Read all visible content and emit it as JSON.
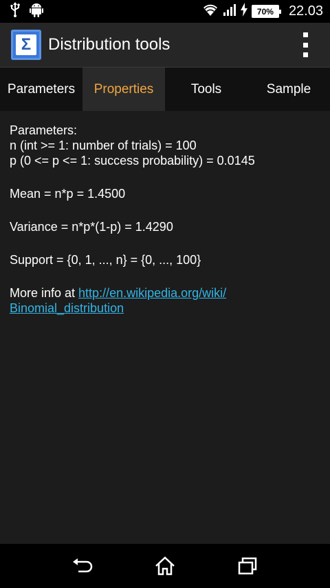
{
  "status_bar": {
    "time": "22.03",
    "battery": "70%",
    "icons": [
      "usb-icon",
      "android-icon",
      "wifi-icon",
      "signal-icon",
      "charging-icon",
      "battery-icon"
    ]
  },
  "action_bar": {
    "app_icon_glyph": "Σ",
    "title": "Distribution tools",
    "overflow": "overflow-menu-icon"
  },
  "tabs": [
    {
      "label": "Parameters",
      "active": false
    },
    {
      "label": "Properties",
      "active": true
    },
    {
      "label": "Tools",
      "active": false
    },
    {
      "label": "Sample",
      "active": false
    }
  ],
  "content": {
    "params_heading": "Parameters:",
    "param_n": "n (int >= 1: number of trials) = 100",
    "param_p": "p (0 <= p <= 1: success probability) = 0.0145",
    "mean": "Mean = n*p = 1.4500",
    "variance": "Variance = n*p*(1-p) = 1.4290",
    "support": "Support = {0, 1, ..., n} = {0, ..., 100}",
    "more_info_prefix": "More info at ",
    "link_line1": "http://en.wikipedia.org/wiki/",
    "link_line2": "Binomial_distribution"
  },
  "nav_bar": [
    "back-icon",
    "home-icon",
    "recent-apps-icon"
  ],
  "colors": {
    "accent_tab": "#f2a640",
    "link": "#33b5e5",
    "app_icon_bg": "#3a78d8"
  }
}
